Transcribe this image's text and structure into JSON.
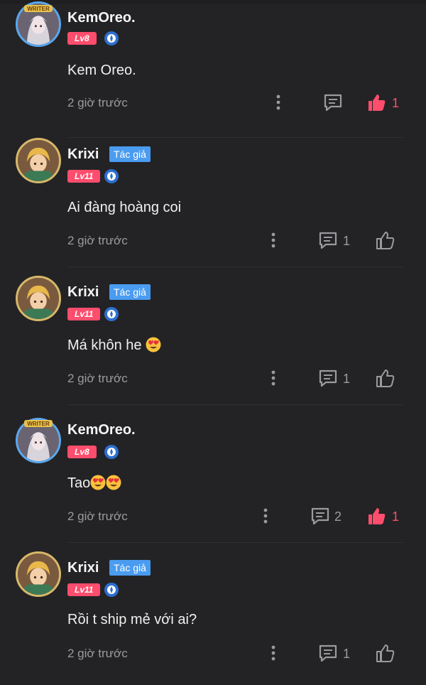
{
  "comments": [
    {
      "username": "KemOreo.",
      "author_badge": "",
      "level": "Lv8",
      "text": "Kem Oreo.",
      "time": "2 giờ trước",
      "reply_count": "",
      "like_count": "1",
      "liked": true
    },
    {
      "username": "Krixi",
      "author_badge": "Tác giả",
      "level": "Lv11",
      "text": "Ai đàng hoàng coi",
      "time": "2 giờ trước",
      "reply_count": "1",
      "like_count": "",
      "liked": false
    },
    {
      "username": "Krixi",
      "author_badge": "Tác giả",
      "level": "Lv11",
      "text": "Má khôn he",
      "time": "2 giờ trước",
      "reply_count": "1",
      "like_count": "",
      "liked": false
    },
    {
      "username": "KemOreo.",
      "author_badge": "",
      "level": "Lv8",
      "text": "Tao",
      "time": "2 giờ trước",
      "reply_count": "2",
      "like_count": "1",
      "liked": true
    },
    {
      "username": "Krixi",
      "author_badge": "Tác giả",
      "level": "Lv11",
      "text": "Rồi t ship mẻ với ai?",
      "time": "2 giờ trước",
      "reply_count": "1",
      "like_count": "",
      "liked": false
    }
  ],
  "colors": {
    "accent": "#ff4d6d",
    "badge_blue": "#4a9cf0",
    "background": "#232325",
    "muted": "#9b9b9f"
  },
  "avatar_frame_label": "WRITER",
  "icons": [
    "medal-icon",
    "more-icon",
    "reply-icon",
    "like-icon",
    "heart-eyes-emoji"
  ]
}
